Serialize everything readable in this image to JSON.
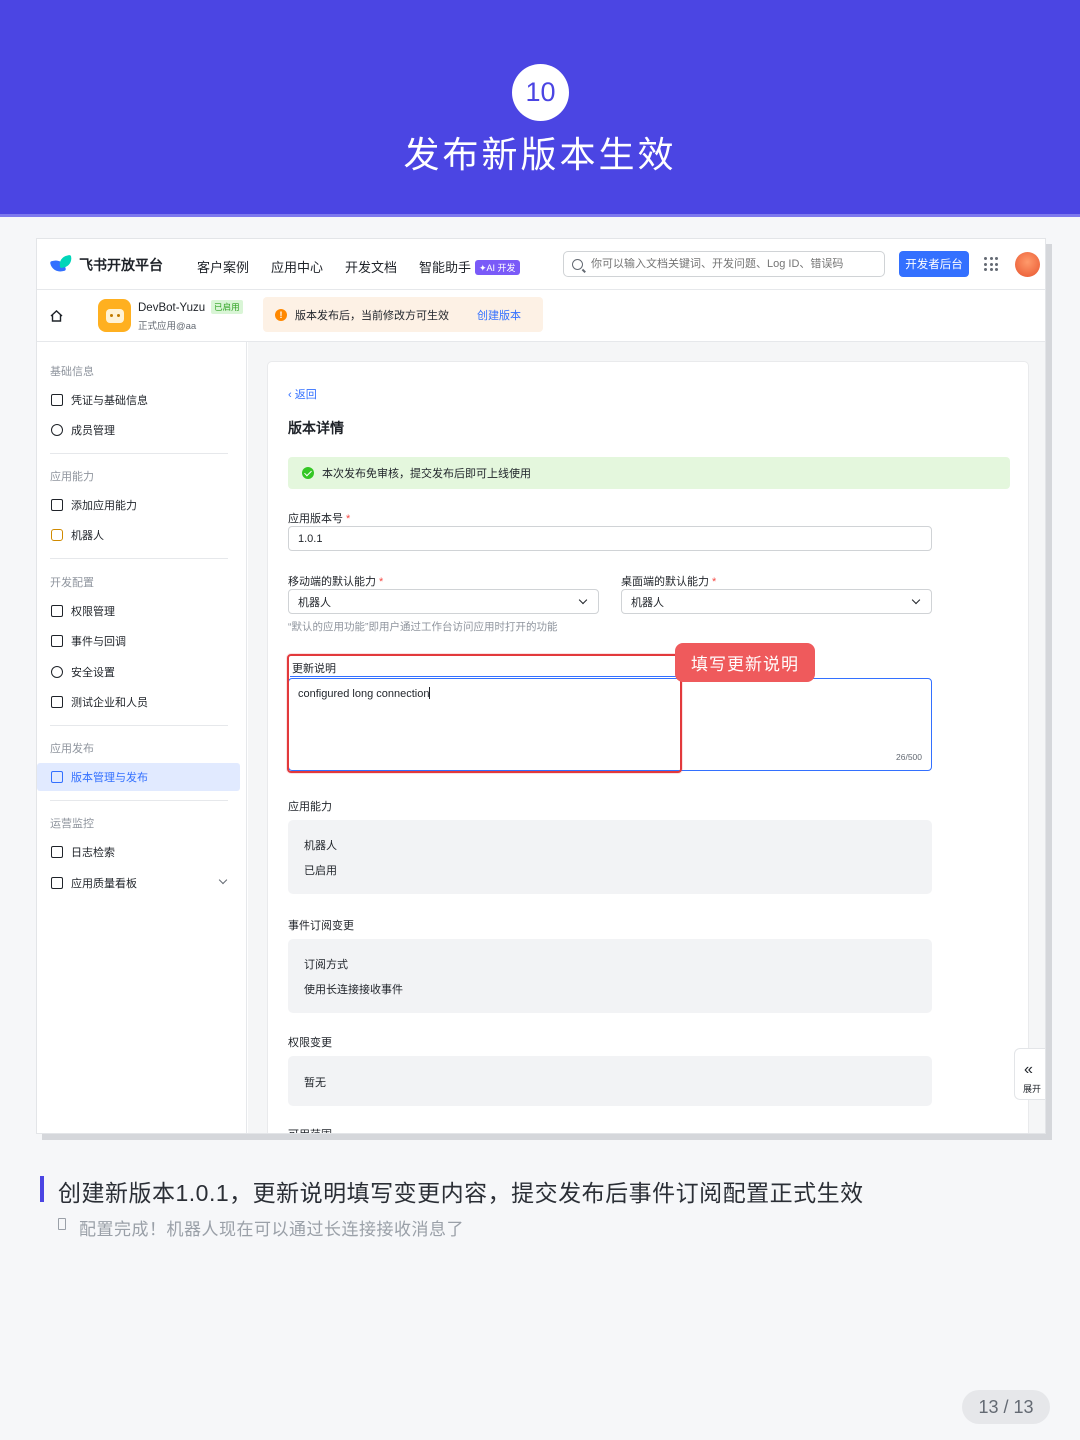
{
  "banner": {
    "step_number": "10",
    "title": "发布新版本生效"
  },
  "topnav": {
    "logo_text": "飞书开放平台",
    "items": [
      "客户案例",
      "应用中心",
      "开发文档",
      "智能助手"
    ],
    "ai_badge": "✦AI 开发",
    "search_placeholder": "你可以输入文档关键词、开发问题、Log ID、错误码",
    "dev_button": "开发者后台"
  },
  "app_bar": {
    "app_name": "DevBot-Yuzu",
    "enabled_tag": "已启用",
    "app_sub": "正式应用@aa",
    "notice_text": "版本发布后，当前修改方可生效",
    "notice_link": "创建版本"
  },
  "sidebar": {
    "groups": [
      {
        "title": "基础信息",
        "items": [
          "凭证与基础信息",
          "成员管理"
        ]
      },
      {
        "title": "应用能力",
        "items": [
          "添加应用能力",
          "机器人"
        ]
      },
      {
        "title": "开发配置",
        "items": [
          "权限管理",
          "事件与回调",
          "安全设置",
          "测试企业和人员"
        ]
      },
      {
        "title": "应用发布",
        "items": [
          "版本管理与发布"
        ]
      },
      {
        "title": "运营监控",
        "items": [
          "日志检索",
          "应用质量看板"
        ]
      }
    ]
  },
  "form": {
    "back": "返回",
    "title": "版本详情",
    "success_text": "本次发布免审核，提交发布后即可上线使用",
    "version_label": "应用版本号",
    "version_value": "1.0.1",
    "mobile_label": "移动端的默认能力",
    "mobile_value": "机器人",
    "desktop_label": "桌面端的默认能力",
    "desktop_value": "机器人",
    "default_hint": "“默认的应用功能”即用户通过工作台访问应用时打开的功能",
    "notes_label": "更新说明",
    "notes_value": "configured long connection",
    "notes_counter": "26/500",
    "ability_label": "应用能力",
    "ability_lines": [
      "机器人",
      "已启用"
    ],
    "event_label": "事件订阅变更",
    "event_lines": [
      "订阅方式",
      "使用长连接接收事件"
    ],
    "perm_label": "权限变更",
    "perm_lines": [
      "暂无"
    ],
    "range_label": "可用范围"
  },
  "annotation": {
    "callout": "填写更新说明"
  },
  "expand": {
    "icon": "«",
    "label": "展开"
  },
  "caption": {
    "title": "创建新版本1.0.1，更新说明填写变更内容，提交发布后事件订阅配置正式生效",
    "subtitle": "配置完成！机器人现在可以通过长连接接收消息了"
  },
  "pager": "13 / 13",
  "colors": {
    "brand": "#4b45e3",
    "primary": "#3370ff",
    "highlight": "#e2393c",
    "callout": "#ef5a5c"
  }
}
